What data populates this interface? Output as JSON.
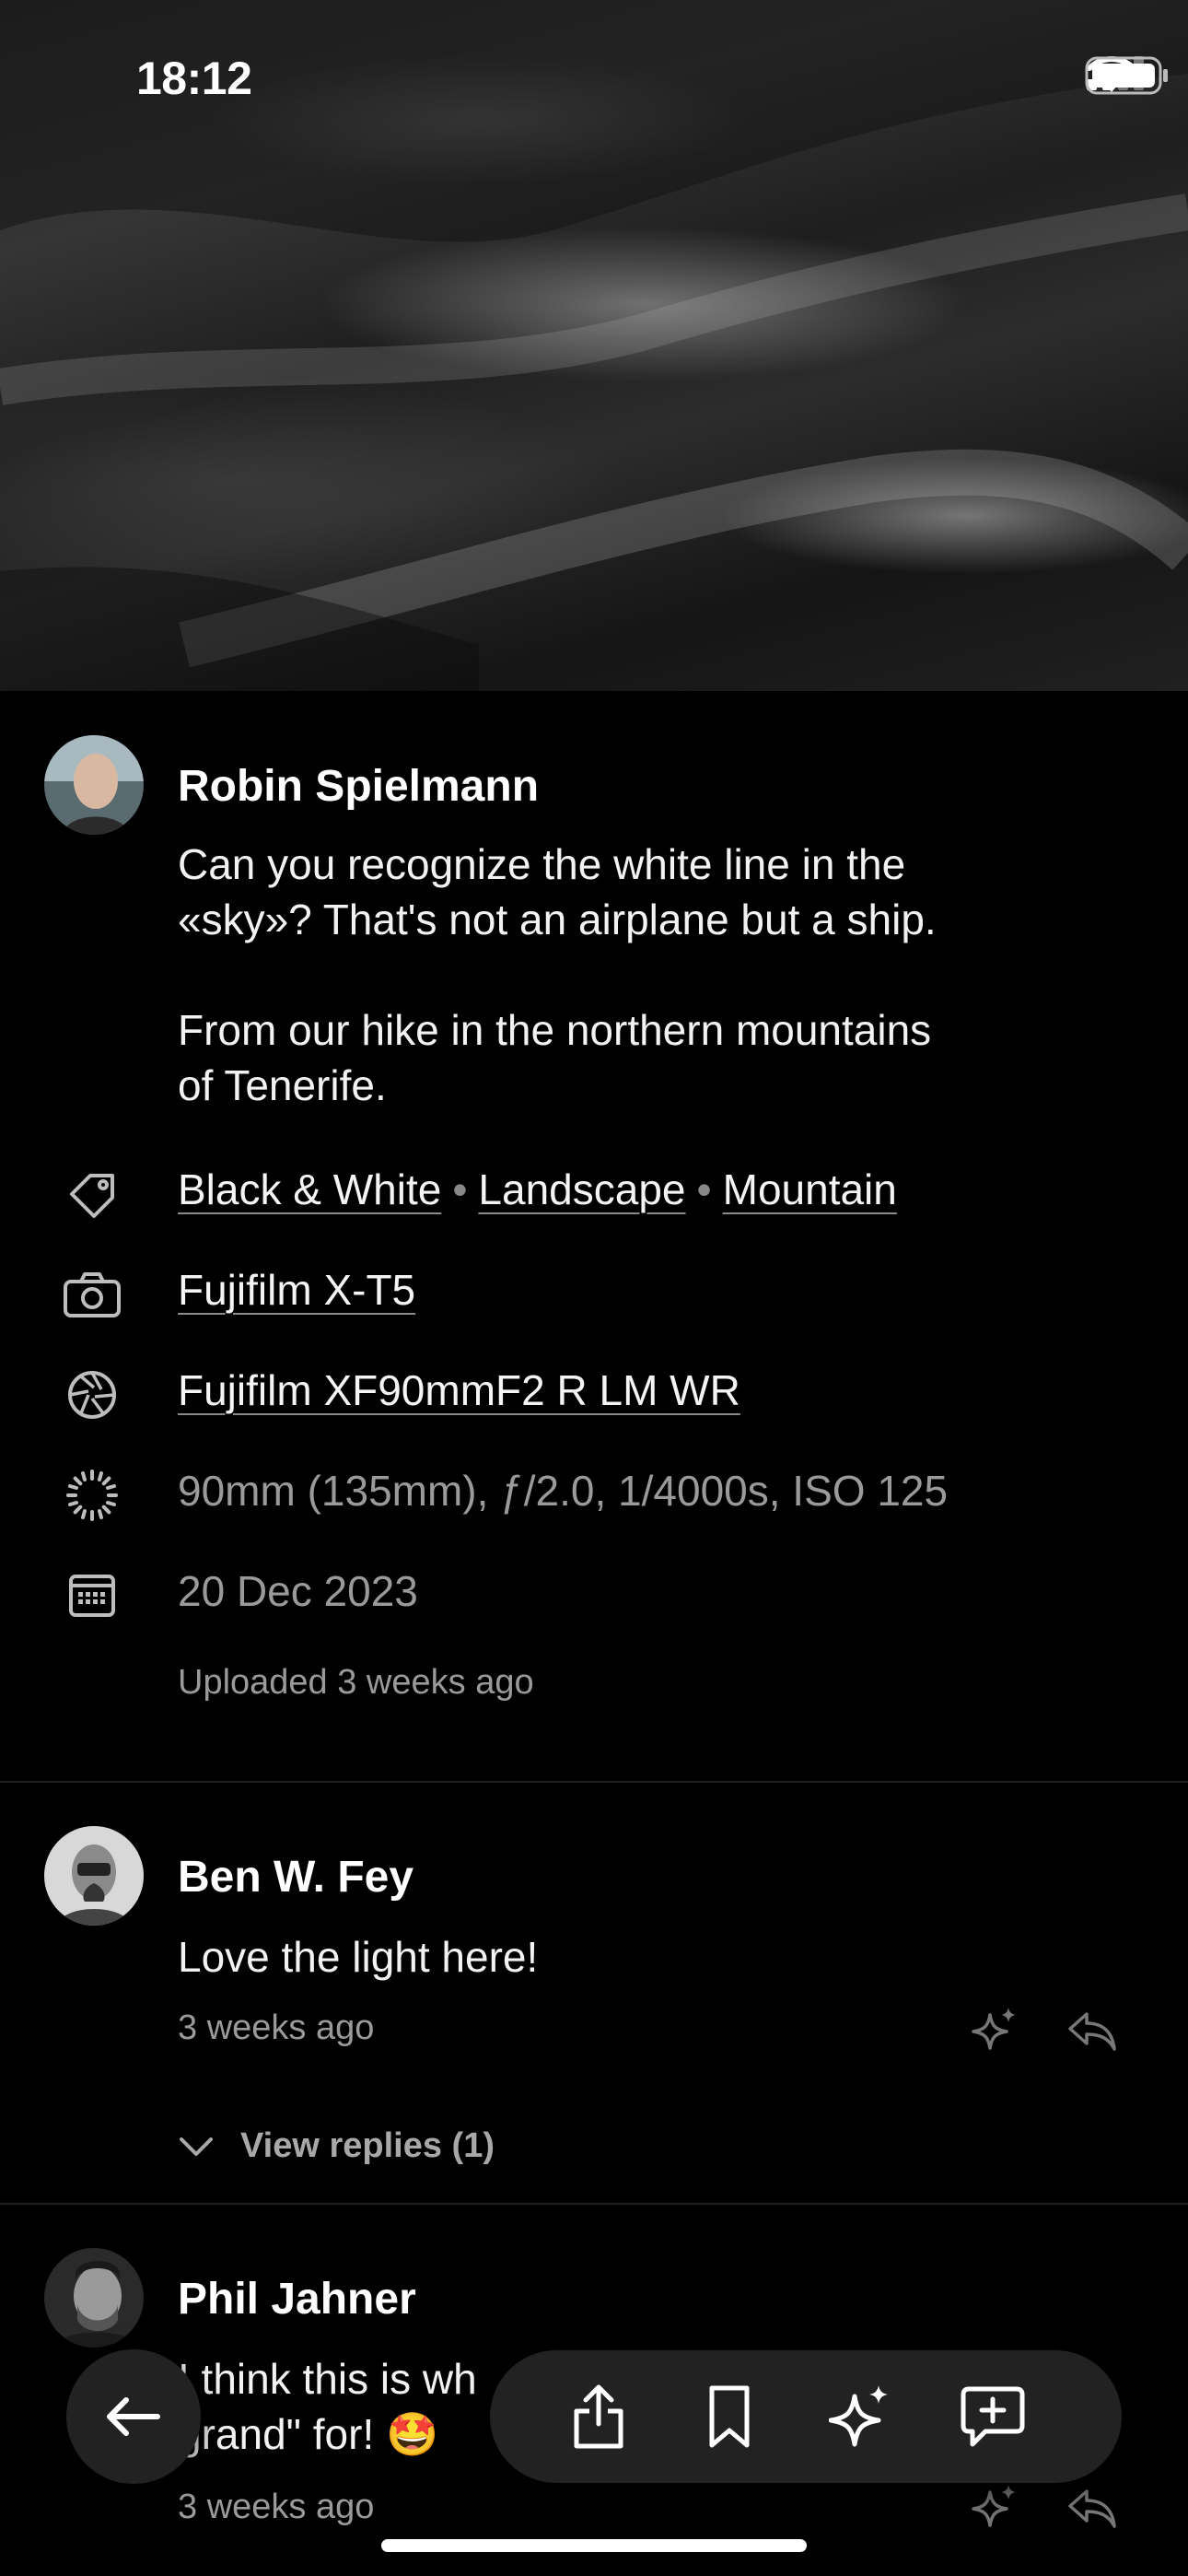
{
  "status_bar": {
    "time": "18:12"
  },
  "post": {
    "author": "Robin Spielmann",
    "description_line1": "Can you recognize the white line in the",
    "description_line2": "«sky»? That's not an airplane but a ship.",
    "description_line3": "From our hike in the northern mountains",
    "description_line4": "of Tenerife.",
    "tags": [
      "Black & White",
      "Landscape",
      "Mountain"
    ],
    "tag_separator": "•",
    "camera": "Fujifilm X-T5",
    "lens": "Fujifilm XF90mmF2 R LM WR",
    "exposure": "90mm (135mm), ƒ/2.0, 1/4000s, ISO 125",
    "date": "20 Dec 2023",
    "uploaded": "Uploaded 3 weeks ago"
  },
  "comments": [
    {
      "author": "Ben W. Fey",
      "text": "Love the light here!",
      "time": "3 weeks ago",
      "view_replies": "View replies (1)"
    },
    {
      "author": "Phil Jahner",
      "text_line1": "I think this is wh",
      "text_line2": "grand\" for! 🤩",
      "time": "3 weeks ago"
    }
  ],
  "icons": {
    "tag": "tag-icon",
    "camera": "camera-icon",
    "lens": "aperture-icon",
    "exposure": "exposure-icon",
    "date": "calendar-icon",
    "back": "arrow-left-icon",
    "share": "share-icon",
    "bookmark": "bookmark-icon",
    "sparkle": "sparkle-icon",
    "comment": "add-comment-icon",
    "reply": "reply-icon"
  }
}
